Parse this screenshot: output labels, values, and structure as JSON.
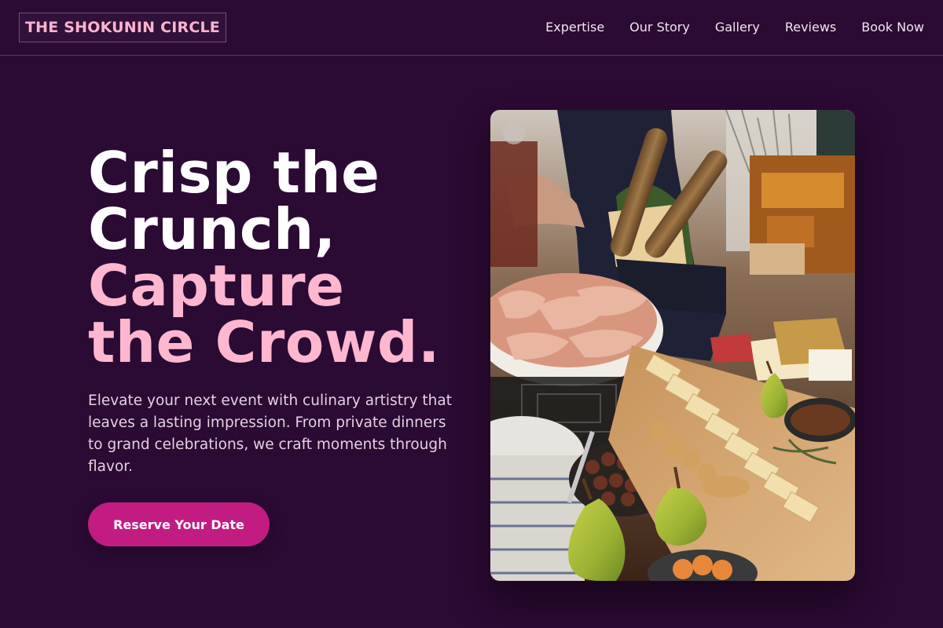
{
  "brand": {
    "name": "THE SHOKUNIN CIRCLE"
  },
  "nav": {
    "items": [
      {
        "label": "Expertise"
      },
      {
        "label": "Our Story"
      },
      {
        "label": "Gallery"
      },
      {
        "label": "Reviews"
      },
      {
        "label": "Book Now"
      }
    ]
  },
  "hero": {
    "title_lines": [
      "Crisp the",
      "Crunch,"
    ],
    "accent_lines": [
      "Capture",
      "the Crowd."
    ],
    "description": "Elevate your next event with culinary artistry that leaves a lasting impression. From private dinners to grand celebrations, we craft moments through flavor.",
    "cta_label": "Reserve Your Date"
  },
  "colors": {
    "background": "#2b0a33",
    "accent_pink": "#ffb7cf",
    "cta": "#c21c82"
  }
}
